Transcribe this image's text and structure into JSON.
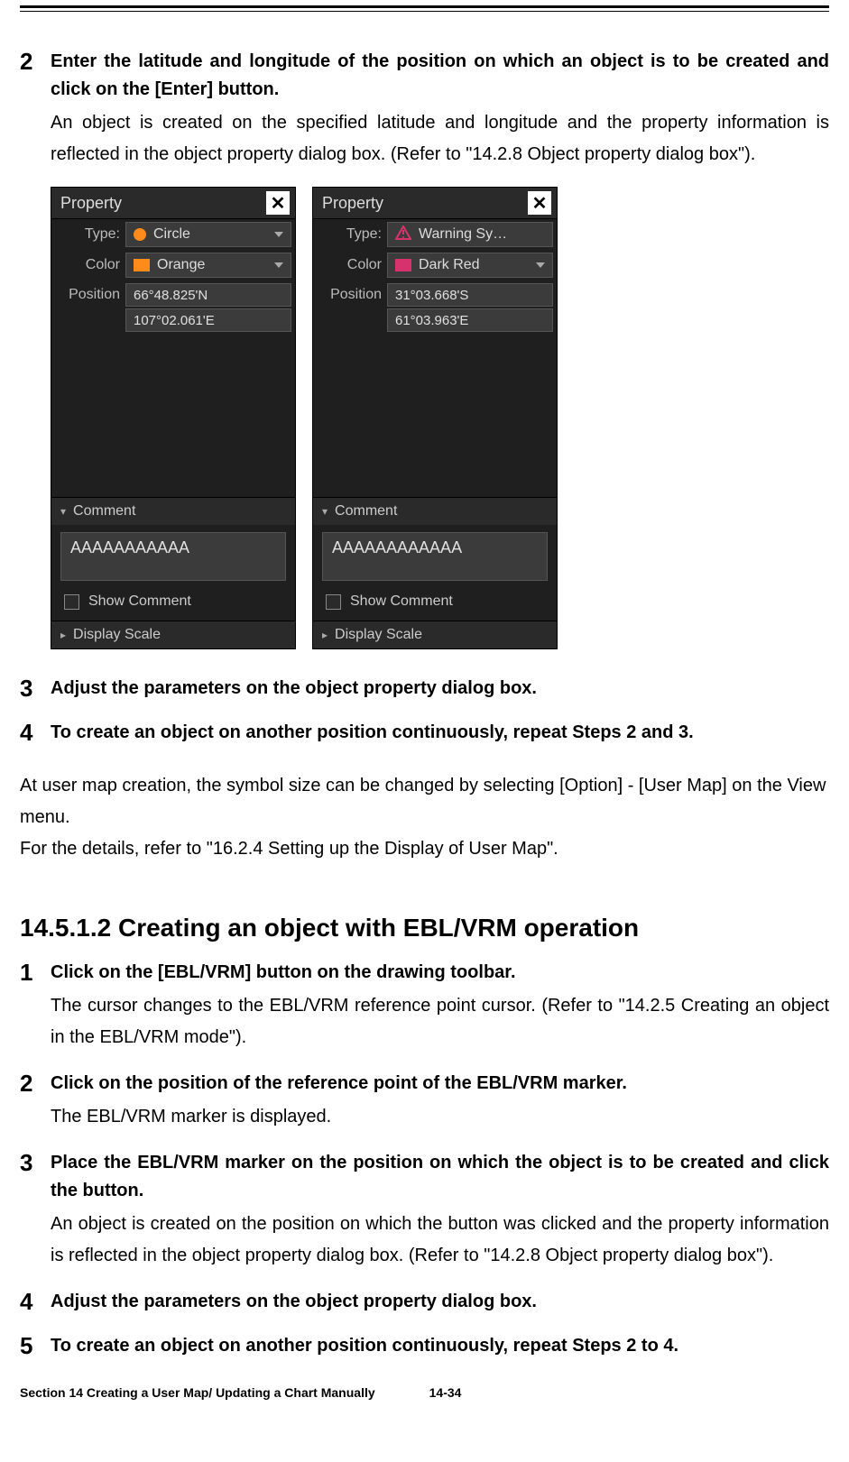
{
  "steps_top": [
    {
      "num": "2",
      "title": "Enter the latitude and longitude of the position on which an object is to be created and click on the [Enter] button.",
      "desc": "An object is created on the specified latitude and longitude and the property information is reflected in the object property dialog box. (Refer to \"14.2.8 Object property dialog box\")."
    },
    {
      "num": "3",
      "title": "Adjust the parameters on the object property dialog box.",
      "desc": ""
    },
    {
      "num": "4",
      "title": "To create an object on another position continuously, repeat Steps 2 and 3.",
      "desc": ""
    }
  ],
  "panels": {
    "left": {
      "title": "Property",
      "type_label": "Type:",
      "type_value": "Circle",
      "color_label": "Color",
      "color_value": "Orange",
      "position_label": "Position",
      "lat": "66°48.825'N",
      "lon": "107°02.061'E",
      "comment_section": "Comment",
      "comment_value": "AAAAAAAAAAA",
      "show_comment": "Show Comment",
      "display_scale": "Display Scale"
    },
    "right": {
      "title": "Property",
      "type_label": "Type:",
      "type_value": "Warning Sy…",
      "color_label": "Color",
      "color_value": "Dark Red",
      "position_label": "Position",
      "lat": "31°03.668'S",
      "lon": "61°03.963'E",
      "comment_section": "Comment",
      "comment_value": "AAAAAAAAAAAA",
      "show_comment": "Show Comment",
      "display_scale": "Display Scale"
    }
  },
  "mid_para1": "At user map creation, the symbol size can be changed by selecting [Option] - [User Map] on the View menu.",
  "mid_para2": "For the details, refer to \"16.2.4 Setting up the Display of User Map\".",
  "subheading": "14.5.1.2    Creating an object with EBL/VRM operation",
  "steps_bottom": [
    {
      "num": "1",
      "title": "Click on the [EBL/VRM] button on the drawing toolbar.",
      "desc": "The cursor changes to the EBL/VRM reference point cursor. (Refer to \"14.2.5 Creating an object in the EBL/VRM mode\")."
    },
    {
      "num": "2",
      "title": "Click on the position of the reference point of the EBL/VRM marker.",
      "desc": "The EBL/VRM marker is displayed."
    },
    {
      "num": "3",
      "title": "Place the EBL/VRM marker on the position on which the object is to be created and click the button.",
      "desc": "An object is created on the position on which the button was clicked and the property information is reflected in the object property dialog box. (Refer to \"14.2.8 Object property dialog box\")."
    },
    {
      "num": "4",
      "title": "Adjust the parameters on the object property dialog box.",
      "desc": ""
    },
    {
      "num": "5",
      "title": "To create an object on another position continuously, repeat Steps 2 to 4.",
      "desc": ""
    }
  ],
  "footer": {
    "section": "Section 14    Creating a User Map/ Updating a Chart Manually",
    "page": "14-34"
  }
}
